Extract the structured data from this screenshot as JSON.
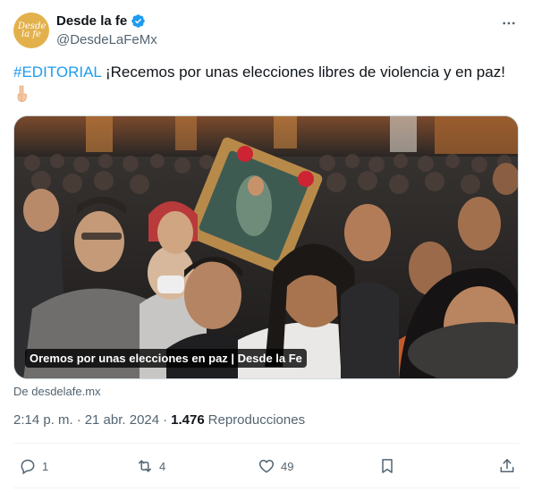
{
  "author": {
    "avatar_text": "Desde la fe",
    "display_name": "Desde la fe",
    "handle": "@DesdeLaFeMx",
    "verified_icon": "verified-badge-icon"
  },
  "tweet": {
    "hashtag": "#EDITORIAL",
    "text": " ¡Recemos por unas elecciones libres de violencia y en paz!",
    "emoji_icon": "pointing-down-hand-icon"
  },
  "media": {
    "caption": "Oremos por unas elecciones en paz | Desde la Fe"
  },
  "link_source": "De desdelafe.mx",
  "meta": {
    "time": "2:14 p. m.",
    "separator": "·",
    "date": "21 abr. 2024",
    "views_count": "1.476",
    "views_label": "Reproducciones"
  },
  "actions": {
    "replies": "1",
    "reposts": "4",
    "likes": "49"
  },
  "colors": {
    "accent": "#1d9bf0",
    "text": "#0f1419",
    "secondary": "#536471",
    "divider": "#eff3f4"
  }
}
